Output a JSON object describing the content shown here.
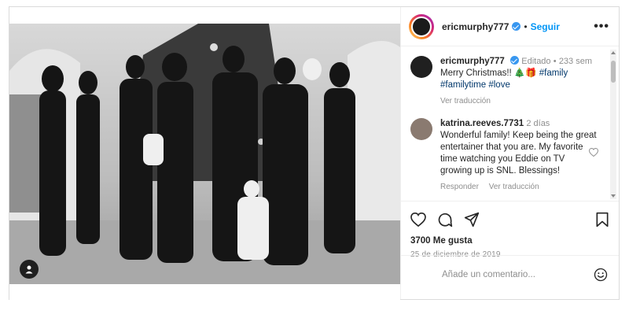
{
  "post": {
    "username": "ericmurphy777",
    "follow_label": "Seguir",
    "more_label": "•••"
  },
  "caption": {
    "username": "ericmurphy777",
    "edited": "Editado",
    "time": "233 sem",
    "text": "Merry Christmas!! 🎄🎁",
    "tags_inline": "#family",
    "tags_line2": "#familytime #love",
    "see_translation": "Ver traducción"
  },
  "comment": {
    "username": "katrina.reeves.7731",
    "time": "2 días",
    "text": "Wonderful family! Keep being the great entertainer that you are. My favorite time watching you Eddie on TV growing up is SNL. Blessings!",
    "reply": "Responder",
    "see_translation": "Ver traducción"
  },
  "actions": {
    "icons": [
      "heart-icon",
      "comment-icon",
      "share-icon",
      "bookmark-icon"
    ],
    "likes": "3700 Me gusta",
    "date": "25 de diciembre de 2019"
  },
  "add_comment": {
    "placeholder": "Añade un comentario...",
    "emoji_icon": "smiley-icon"
  },
  "colors": {
    "link": "#0095f6",
    "hashtag": "#00376b",
    "verified": "#3897f0",
    "muted": "#8e8e8e"
  }
}
